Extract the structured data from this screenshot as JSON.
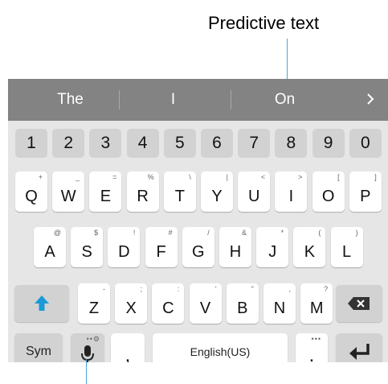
{
  "callout": {
    "top_label": "Predictive text"
  },
  "prediction_bar": {
    "suggestions": [
      "The",
      "I",
      "On"
    ],
    "next_icon": "chevron-right-icon"
  },
  "number_row": [
    "1",
    "2",
    "3",
    "4",
    "5",
    "6",
    "7",
    "8",
    "9",
    "0"
  ],
  "row_q": [
    {
      "key": "Q",
      "sub": "+"
    },
    {
      "key": "W",
      "sub": "_"
    },
    {
      "key": "E",
      "sub": "="
    },
    {
      "key": "R",
      "sub": "%"
    },
    {
      "key": "T",
      "sub": "\\"
    },
    {
      "key": "Y",
      "sub": "|"
    },
    {
      "key": "U",
      "sub": "<"
    },
    {
      "key": "I",
      "sub": ">"
    },
    {
      "key": "O",
      "sub": "["
    },
    {
      "key": "P",
      "sub": "]"
    }
  ],
  "row_a": [
    {
      "key": "A",
      "sub": "@"
    },
    {
      "key": "S",
      "sub": "$"
    },
    {
      "key": "D",
      "sub": "!"
    },
    {
      "key": "F",
      "sub": "#"
    },
    {
      "key": "G",
      "sub": "/"
    },
    {
      "key": "H",
      "sub": "&"
    },
    {
      "key": "J",
      "sub": "*"
    },
    {
      "key": "K",
      "sub": "("
    },
    {
      "key": "L",
      "sub": ")"
    }
  ],
  "row_z": [
    {
      "key": "Z",
      "sub": "-"
    },
    {
      "key": "X",
      "sub": ";"
    },
    {
      "key": "C",
      "sub": ":"
    },
    {
      "key": "V",
      "sub": "'"
    },
    {
      "key": "B",
      "sub": "\""
    },
    {
      "key": "N",
      "sub": ","
    },
    {
      "key": "M",
      "sub": "?"
    }
  ],
  "bottom_row": {
    "sym": "Sym",
    "comma": ",",
    "space": "English(US)",
    "period": ".",
    "dots": "•••"
  },
  "icons": {
    "shift": "shift-arrow-icon",
    "backspace": "backspace-icon",
    "mic": "microphone-icon",
    "enter": "enter-icon"
  },
  "colors": {
    "prediction_bar": "#838383",
    "keyboard_bg": "#e6e6e6",
    "number_key": "#d2d2d2",
    "letter_key": "#ffffff",
    "accent": "#1a9ad6"
  }
}
